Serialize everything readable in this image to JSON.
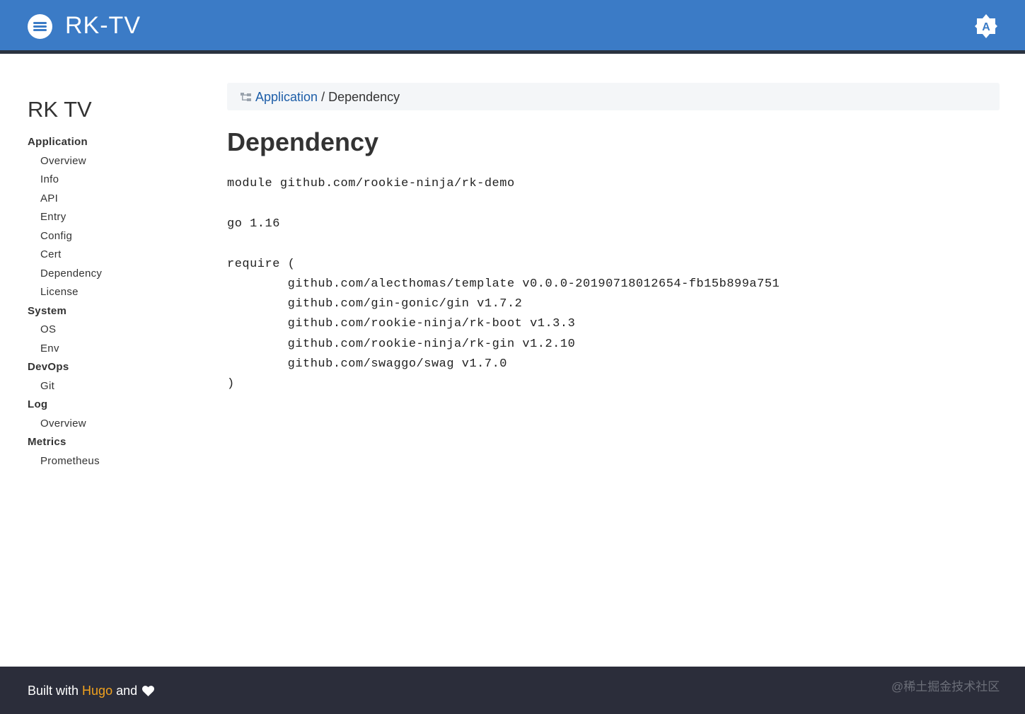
{
  "header": {
    "site_title": "RK-TV",
    "menu_icon": "hamburger-menu-icon",
    "theme_toggle_icon": "auto-theme-icon",
    "theme_toggle_letter": "A",
    "accent_color": "#3b7bc6"
  },
  "sidebar": {
    "title": "RK TV",
    "sections": [
      {
        "label": "Application",
        "items": [
          "Overview",
          "Info",
          "API",
          "Entry",
          "Config",
          "Cert",
          "Dependency",
          "License"
        ]
      },
      {
        "label": "System",
        "items": [
          "OS",
          "Env"
        ]
      },
      {
        "label": "DevOps",
        "items": [
          "Git"
        ]
      },
      {
        "label": "Log",
        "items": [
          "Overview"
        ]
      },
      {
        "label": "Metrics",
        "items": [
          "Prometheus"
        ]
      }
    ]
  },
  "breadcrumb": {
    "icon": "sitemap-icon",
    "parent": "Application",
    "separator": "/",
    "current": "Dependency"
  },
  "main": {
    "heading": "Dependency",
    "code_lines": [
      "module github.com/rookie-ninja/rk-demo",
      "",
      "go 1.16",
      "",
      "require (",
      "\tgithub.com/alecthomas/template v0.0.0-20190718012654-fb15b899a751",
      "\tgithub.com/gin-gonic/gin v1.7.2",
      "\tgithub.com/rookie-ninja/rk-boot v1.3.3",
      "\tgithub.com/rookie-ninja/rk-gin v1.2.10",
      "\tgithub.com/swaggo/swag v1.7.0",
      ")"
    ]
  },
  "footer": {
    "built_with": "Built with",
    "hugo_link": "Hugo",
    "and": "and",
    "heart_icon": "heart-icon",
    "watermark": "@稀土掘金技术社区",
    "link_color": "#f0a11e"
  }
}
